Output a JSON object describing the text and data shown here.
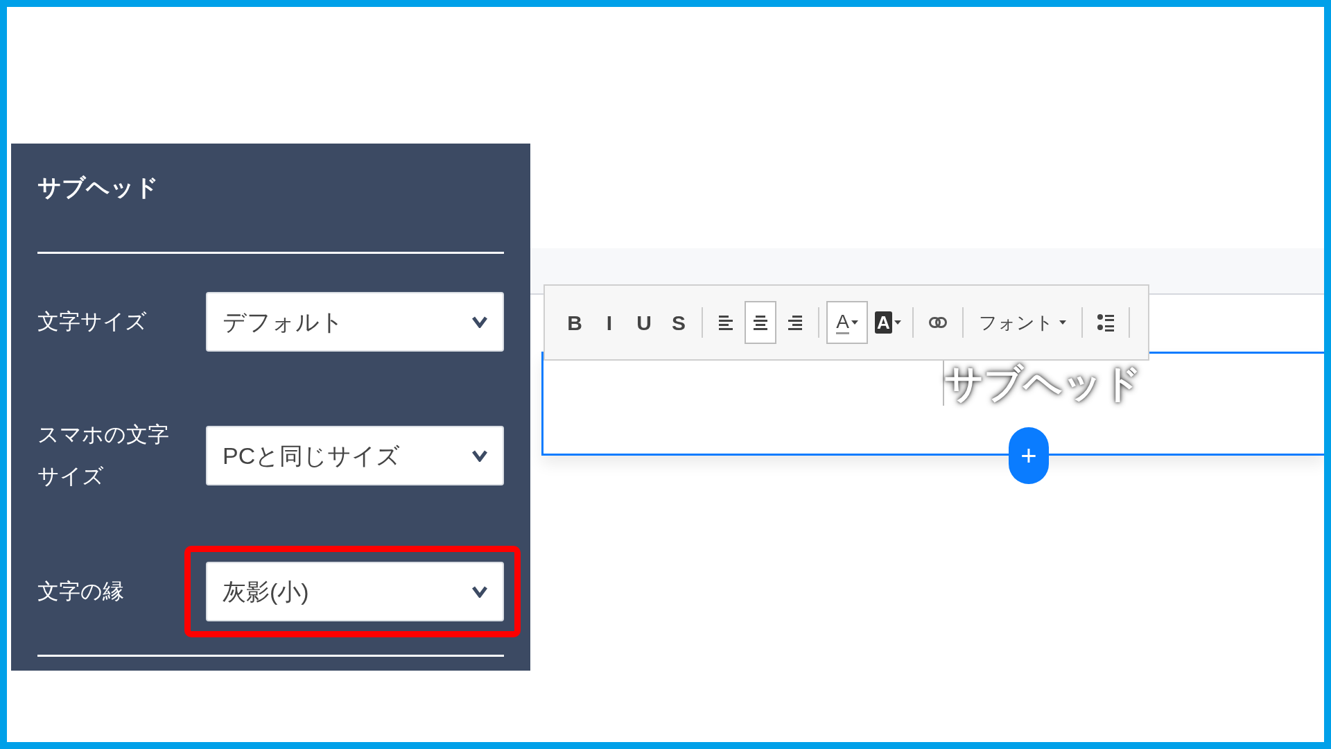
{
  "panel": {
    "title": "サブヘッド",
    "settings": [
      {
        "label": "文字サイズ",
        "value": "デフォルト",
        "highlighted": false
      },
      {
        "label": "スマホの文字サイズ",
        "value": "PCと同じサイズ",
        "highlighted": false
      },
      {
        "label": "文字の縁",
        "value": "灰影(小)",
        "highlighted": true
      }
    ]
  },
  "toolbar": [
    {
      "kind": "letter",
      "text": "B",
      "selected": false
    },
    {
      "kind": "letter",
      "text": "I",
      "selected": false
    },
    {
      "kind": "letter",
      "text": "U",
      "selected": false
    },
    {
      "kind": "letter",
      "text": "S",
      "selected": false
    },
    {
      "kind": "align-left",
      "selected": false
    },
    {
      "kind": "align-center",
      "selected": true
    },
    {
      "kind": "align-right",
      "selected": false
    },
    {
      "kind": "text-color",
      "text": "A",
      "selected": true
    },
    {
      "kind": "highlight",
      "text": "A",
      "selected": false
    },
    {
      "kind": "link",
      "selected": false
    },
    {
      "kind": "font",
      "text": "フォント",
      "selected": false
    },
    {
      "kind": "list",
      "selected": false
    }
  ],
  "editor": {
    "heading": "サブヘッド",
    "add_button": "+"
  }
}
